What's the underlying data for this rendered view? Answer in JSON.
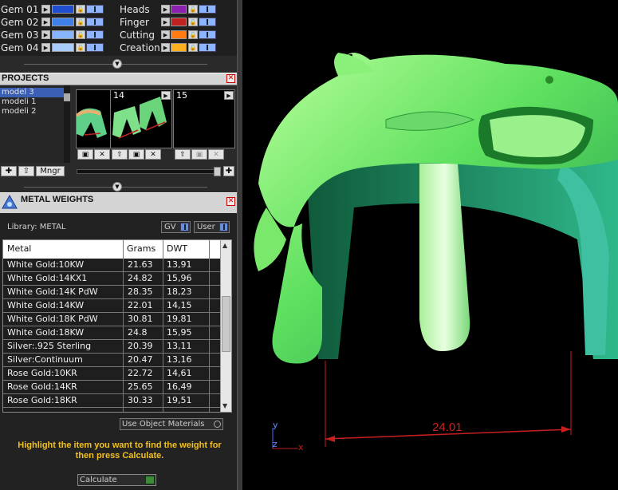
{
  "layers": {
    "left": [
      {
        "name": "Gem 01",
        "color": "#1f4fd0"
      },
      {
        "name": "Gem 02",
        "color": "#3f7fe8"
      },
      {
        "name": "Gem 03",
        "color": "#86b4ff"
      },
      {
        "name": "Gem 04",
        "color": "#a8ccff"
      }
    ],
    "right": [
      {
        "name": "Heads",
        "color": "#8a1fb0"
      },
      {
        "name": "Finger",
        "color": "#c02020"
      },
      {
        "name": "Cutting",
        "color": "#ff7a10"
      },
      {
        "name": "Creation",
        "color": "#ffb020"
      }
    ]
  },
  "projects": {
    "title": "PROJECTS",
    "items": [
      "model 3",
      "modeli 1",
      "modeli 2"
    ],
    "selected_index": 0,
    "tiles": [
      "",
      "14",
      "15"
    ],
    "manager_label": "Mngr"
  },
  "metal_weights": {
    "title": "METAL WEIGHTS",
    "library_label": "Library: METAL",
    "unit_gv": "GV",
    "unit_user": "User",
    "columns": [
      "Metal",
      "Grams",
      "DWT"
    ],
    "rows": [
      [
        "White Gold:10KW",
        "21.63",
        "13,91"
      ],
      [
        "White Gold:14KX1",
        "24.82",
        "15,96"
      ],
      [
        "White Gold:14K PdW",
        "28.35",
        "18,23"
      ],
      [
        "White Gold:14KW",
        "22.01",
        "14,15"
      ],
      [
        "White Gold:18K PdW",
        "30.81",
        "19,81"
      ],
      [
        "White Gold:18KW",
        "24.8",
        "15,95"
      ],
      [
        "Silver:.925 Sterling",
        "20.39",
        "13,11"
      ],
      [
        "Silver:Continuum",
        "20.47",
        "13,16"
      ],
      [
        "Rose Gold:10KR",
        "22.72",
        "14,61"
      ],
      [
        "Rose Gold:14KR",
        "25.65",
        "16,49"
      ],
      [
        "Rose Gold:18KR",
        "30.33",
        "19,51"
      ]
    ],
    "use_object_materials": "Use Object Materials",
    "hint": "Highlight the item you want to find the weight for then press Calculate.",
    "calculate_label": "Calculate"
  },
  "viewport": {
    "dimension_value": "24.01",
    "axis_y": "y",
    "axis_z": "z",
    "axis_x": "x",
    "model_color": "#5fe05f",
    "dimension_color": "#c82020"
  }
}
